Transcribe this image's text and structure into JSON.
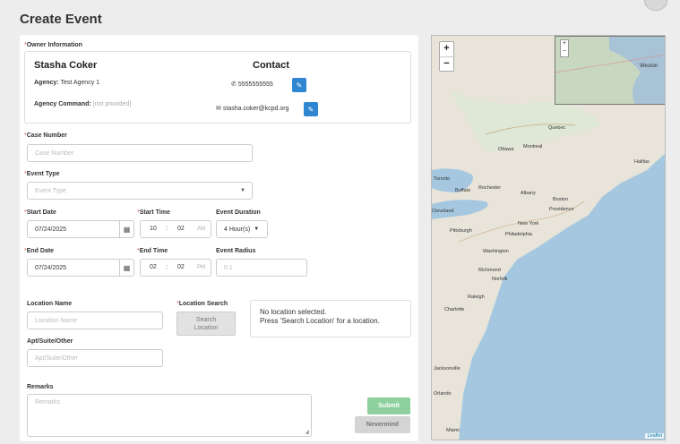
{
  "page": {
    "title": "Create Event"
  },
  "owner": {
    "section_label": "Owner Information",
    "name": "Stasha Coker",
    "agency_label": "Agency:",
    "agency_value": "Test Agency 1",
    "command_label": "Agency Command:",
    "command_value": "[not provided]",
    "contact_title": "Contact",
    "phone": "5555555555",
    "email": "stasha.coker@kcpd.org"
  },
  "case_number": {
    "label": "Case Number",
    "placeholder": "Case Number"
  },
  "event_type": {
    "label": "Event Type",
    "placeholder": "Event Type"
  },
  "start_date": {
    "label": "Start Date",
    "value": "07/24/2025"
  },
  "start_time": {
    "label": "Start Time",
    "hour": "10",
    "minute": "02",
    "ampm": "AM"
  },
  "event_duration": {
    "label": "Event Duration",
    "value": "4 Hour(s)"
  },
  "end_date": {
    "label": "End Date",
    "value": "07/24/2025"
  },
  "end_time": {
    "label": "End Time",
    "hour": "02",
    "minute": "02",
    "ampm": "PM"
  },
  "event_radius": {
    "label": "Event Radius",
    "placeholder": "0.1"
  },
  "location_name": {
    "label": "Location Name",
    "placeholder": "Location Name"
  },
  "location_search": {
    "label": "Location Search",
    "button_line1": "Search",
    "button_line2": "Location"
  },
  "location_status": {
    "line1": "No location selected.",
    "line2": "Press 'Search Location' for a location."
  },
  "apt": {
    "label": "Apt/Suite/Other",
    "placeholder": "Apt/Suite/Other"
  },
  "remarks": {
    "label": "Remarks",
    "placeholder": "Remarks"
  },
  "buttons": {
    "submit": "Submit",
    "nevermind": "Nevermind"
  },
  "map": {
    "zoom_in": "+",
    "zoom_out": "−",
    "attribution": "Leaflet",
    "labels": [
      "Ottawa",
      "Montreal",
      "Toronto",
      "Buffalo",
      "Rochester",
      "Albany",
      "Boston",
      "Providence",
      "Cleveland",
      "Pittsburgh",
      "New York",
      "Philadelphia",
      "Washington",
      "Richmond",
      "Norfolk",
      "Raleigh",
      "Charlotte",
      "Jacksonville",
      "Orlando",
      "Miami",
      "Halifax",
      "Quebec",
      "Weston"
    ],
    "minimap_label": "Weston"
  },
  "colors": {
    "required": "#d9534f",
    "edit_button": "#2f86d1",
    "submit": "#8fd19e",
    "water": "#a5c8e0",
    "land": "#e8e4da"
  }
}
